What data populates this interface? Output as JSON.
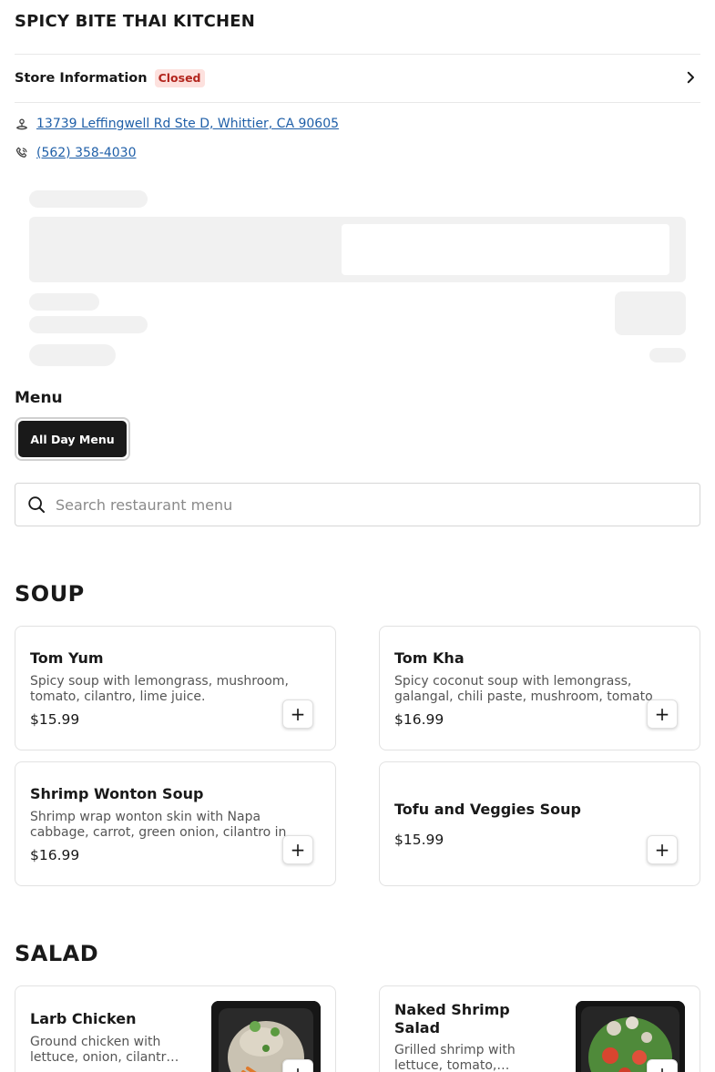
{
  "store": {
    "name": "SPICY BITE THAI KITCHEN"
  },
  "store_info": {
    "label": "Store Information",
    "status": "Closed"
  },
  "contact": {
    "address": "13739 Leffingwell Rd Ste D, Whittier, CA 90605",
    "phone": "(562) 358-4030"
  },
  "menu": {
    "heading": "Menu",
    "selected_menu": "All Day Menu"
  },
  "search": {
    "placeholder": "Search restaurant menu",
    "value": ""
  },
  "sections": [
    {
      "title": "SOUP",
      "items": [
        {
          "name": "Tom Yum",
          "description": "Spicy soup with lemongrass, mushroom, tomato, cilantro, lime juice.",
          "price": "$15.99"
        },
        {
          "name": "Tom Kha",
          "description": "Spicy coconut soup with lemongrass, galangal, chili paste, mushroom, tomato",
          "price": "$16.99"
        },
        {
          "name": "Shrimp Wonton Soup",
          "description": "Shrimp wrap wonton skin with Napa cabbage, carrot, green onion, cilantro in",
          "price": "$16.99"
        },
        {
          "name": "Tofu and Veggies Soup",
          "description": "",
          "price": "$15.99"
        }
      ]
    },
    {
      "title": "SALAD",
      "items": [
        {
          "name": "Larb Chicken",
          "description": "Ground chicken with lettuce, onion, cilantr…",
          "price": ""
        },
        {
          "name": "Naked Shrimp Salad",
          "description": "Grilled shrimp with lettuce, tomato,…",
          "price": ""
        }
      ]
    }
  ],
  "colors": {
    "accent_dark": "#191919",
    "link": "#1f5fa8",
    "closed_bg": "#fde1de",
    "closed_text": "#b3261e"
  },
  "icons": {
    "address": "location-pin-icon",
    "phone": "phone-icon",
    "search": "search-icon",
    "chevron": "chevron-right-icon",
    "add": "plus-icon"
  }
}
